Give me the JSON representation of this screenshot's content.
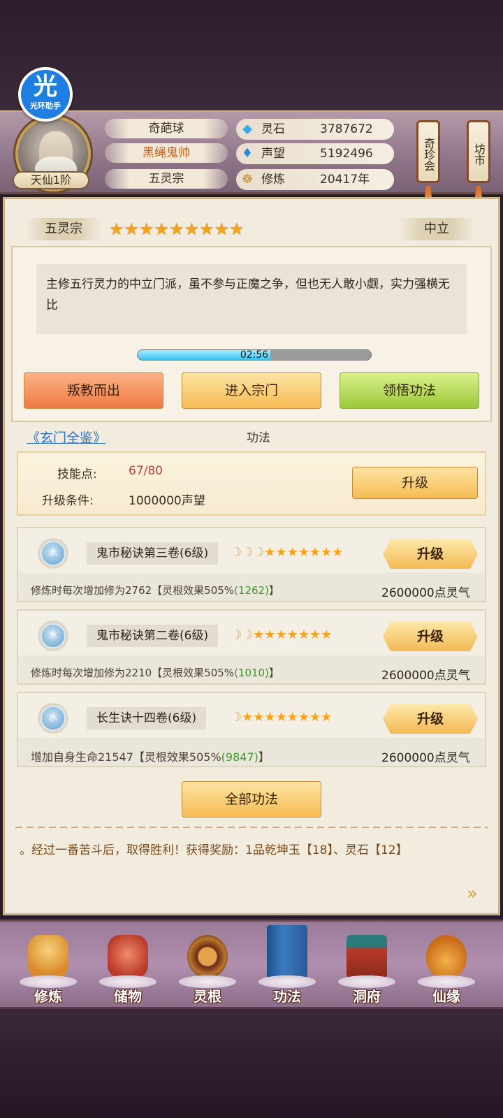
{
  "helper": {
    "icon_text": "光",
    "label": "光环助手"
  },
  "profile": {
    "realm": "天仙1阶",
    "name": "奇葩球",
    "title": "黑绳鬼帅",
    "sect": "五灵宗"
  },
  "stats": [
    {
      "icon": "spirit-stone-icon",
      "label": "灵石",
      "value": "3787672"
    },
    {
      "icon": "reputation-icon",
      "label": "声望",
      "value": "5192496"
    },
    {
      "icon": "cultivation-icon",
      "label": "修炼",
      "value": "20417年"
    }
  ],
  "side_buttons": {
    "treasure": "奇珍会",
    "market": "坊市"
  },
  "sect_panel": {
    "name": "五灵宗",
    "stars": "★★★★★★★★★",
    "alignment": "中立",
    "description": "主修五行灵力的中立门派，虽不参与正魔之争，但也无人敢小觑，实力强横无比",
    "timer": "02:56",
    "timer_progress": 0.57,
    "actions": {
      "leave": "叛教而出",
      "enter": "进入宗门",
      "comprehend": "领悟功法"
    }
  },
  "link_text": "《玄门全鉴》",
  "tab_title": "功法",
  "skill_points": {
    "label": "技能点:",
    "value": "67/80",
    "cond_label": "升级条件:",
    "cond_value": "1000000声望",
    "upgrade": "升级"
  },
  "skills": [
    {
      "element": "水",
      "name": "鬼市秘诀第三卷(6级)",
      "rating": "☽☽☽★★★★★★★",
      "desc_prefix": "修炼时每次增加修为2762【灵根效果505%",
      "desc_bonus": "(1262)",
      "desc_suffix": "】",
      "cost": "2600000点灵气",
      "upgrade": "升级"
    },
    {
      "element": "水",
      "name": "鬼市秘诀第二卷(6级)",
      "rating": "☽☽★★★★★★★",
      "desc_prefix": "修炼时每次增加修为2210【灵根效果505%",
      "desc_bonus": "(1010)",
      "desc_suffix": "】",
      "cost": "2600000点灵气",
      "upgrade": "升级"
    },
    {
      "element": "水",
      "name": "长生诀十四卷(6级)",
      "rating": "☽★★★★★★★★",
      "desc_prefix": "增加自身生命21547【灵根效果505%",
      "desc_bonus": "(9847)",
      "desc_suffix": "】",
      "cost": "2600000点灵气",
      "upgrade": "升级"
    }
  ],
  "all_skills_button": "全部功法",
  "log_text": "。经过一番苦斗后，取得胜利！获得奖励：1品乾坤玉【18】、灵石【12】",
  "nav": [
    {
      "icon": "cultivate-icon",
      "label": "修炼"
    },
    {
      "icon": "storage-icon",
      "label": "储物"
    },
    {
      "icon": "spirit-root-icon",
      "label": "灵根"
    },
    {
      "icon": "technique-book-icon",
      "label": "功法"
    },
    {
      "icon": "cave-dwelling-icon",
      "label": "洞府"
    },
    {
      "icon": "fate-gourd-icon",
      "label": "仙缘"
    }
  ],
  "colors": {
    "accent_gold": "#f6bc54",
    "link_blue": "#2a6fc0",
    "bonus_green": "#3a9a2a",
    "star_orange": "#f5a21c"
  }
}
